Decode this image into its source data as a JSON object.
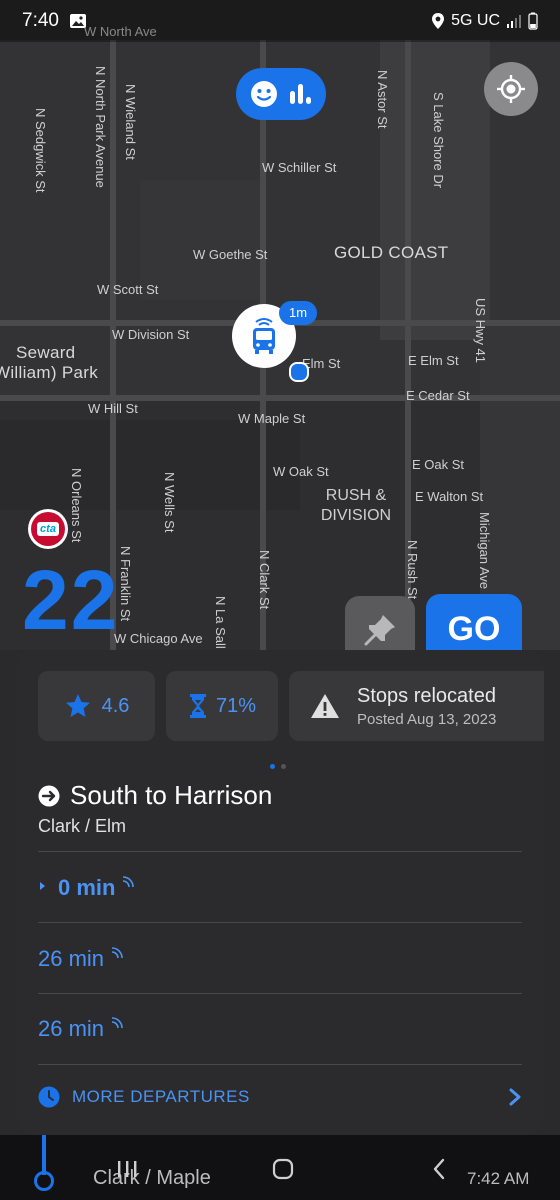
{
  "status_bar": {
    "time": "7:40",
    "network": "5G UC"
  },
  "map": {
    "streets": {
      "w_north_ave": "W North Ave",
      "n_sedgwick": "N Sedgwick St",
      "n_north_park": "N North Park Avenue",
      "n_wieland": "N Wieland St",
      "n_astor": "N Astor St",
      "s_lake_shore": "S Lake Shore Dr",
      "w_schiller": "W Schiller St",
      "w_goethe": "W Goethe St",
      "gold_coast": "GOLD COAST",
      "w_scott": "W Scott St",
      "w_division": "W Division St",
      "us_hwy_41": "US Hwy 41",
      "seward_park_1": "Seward",
      "seward_park_2": "William) Park",
      "elm_st": "Elm St",
      "e_elm": "E Elm St",
      "e_cedar": "E Cedar St",
      "w_hill": "W Hill St",
      "w_maple": "W Maple St",
      "w_oak": "W Oak St",
      "e_oak": "E Oak St",
      "rush_division_1": "RUSH &",
      "rush_division_2": "DIVISION",
      "e_walton": "E Walton St",
      "n_orleans": "N Orleans St",
      "n_wells": "N Wells St",
      "n_franklin": "N Franklin St",
      "n_clark": "N Clark St",
      "n_la_salle": "N La Sall",
      "n_rush": "N Rush St",
      "michigan_ave": "Michigan Ave",
      "w_chicago": "W Chicago Ave"
    },
    "bus_badge": "1m",
    "agency_logo": "cta",
    "route_number": "22",
    "go_label": "GO"
  },
  "sheet": {
    "rating": "4.6",
    "occupancy": "71%",
    "alert_title": "Stops relocated",
    "alert_date": "Posted Aug 13, 2023",
    "direction": "South to Harrison",
    "stop_name": "Clark / Elm",
    "departures": [
      {
        "label": "0 min"
      },
      {
        "label": "26 min"
      },
      {
        "label": "26 min"
      }
    ],
    "more_label": "MORE DEPARTURES"
  },
  "bottom_bar": {
    "stop": "Clark / Maple",
    "time": "7:42 AM"
  },
  "colors": {
    "accent": "#1a73e8",
    "cta_red": "#c60c30",
    "background": "#1f1f21"
  }
}
